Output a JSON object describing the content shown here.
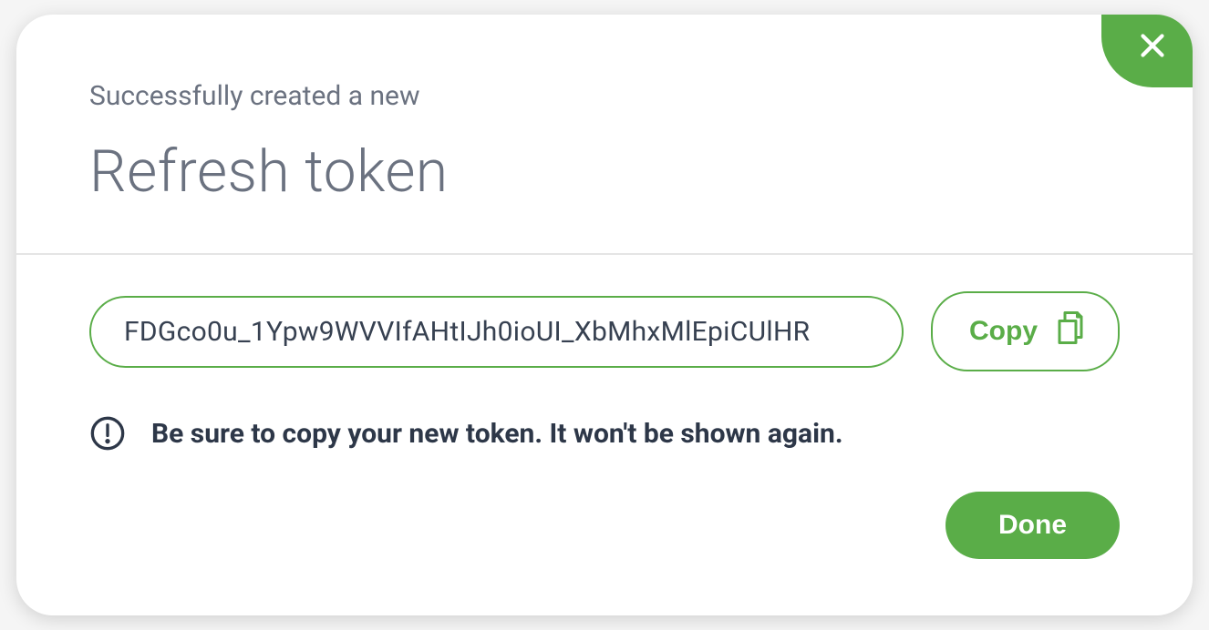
{
  "modal": {
    "subtitle": "Successfully created a new",
    "title": "Refresh token",
    "token_value": "FDGco0u_1Ypw9WVVIfAHtIJh0ioUI_XbMhxMlEpiCUlHR",
    "copy_label": "Copy",
    "warning_text": "Be sure to copy your new token. It won't be shown again.",
    "done_label": "Done"
  },
  "colors": {
    "accent": "#5aad48",
    "text_muted": "#6b7280",
    "text_dark": "#2d3748"
  }
}
